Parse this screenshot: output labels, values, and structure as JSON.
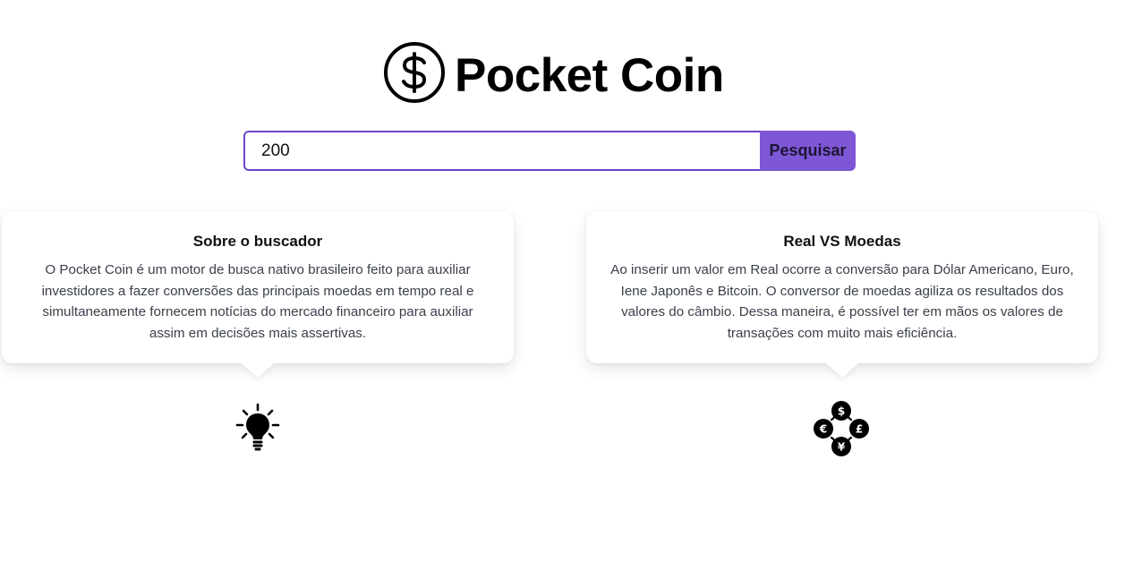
{
  "header": {
    "title": "Pocket Coin",
    "logo_icon": "dollar-circle-icon"
  },
  "search": {
    "value": "200",
    "placeholder": "",
    "button_label": "Pesquisar"
  },
  "colors": {
    "accent": "#7e57d6",
    "accent_border": "#6b45c6",
    "text_primary": "#111111",
    "text_secondary": "#3a3f4a"
  },
  "cards": [
    {
      "title": "Sobre o buscador",
      "text": "O Pocket Coin é um motor de busca nativo brasileiro feito para auxiliar investidores a fazer conversões das principais moedas em tempo real e simultaneamente fornecem notícias do mercado financeiro para auxiliar assim em decisões mais assertivas.",
      "icon": "lightbulb-icon"
    },
    {
      "title": "Real VS Moedas",
      "text": "Ao inserir um valor em Real ocorre a conversão para Dólar Americano, Euro, Iene Japonês e Bitcoin. O conversor de moedas agiliza os resultados dos valores do câmbio. Dessa maneira, é possível ter em mãos os valores de transações com muito mais eficiência.",
      "icon": "currency-exchange-icon"
    }
  ]
}
